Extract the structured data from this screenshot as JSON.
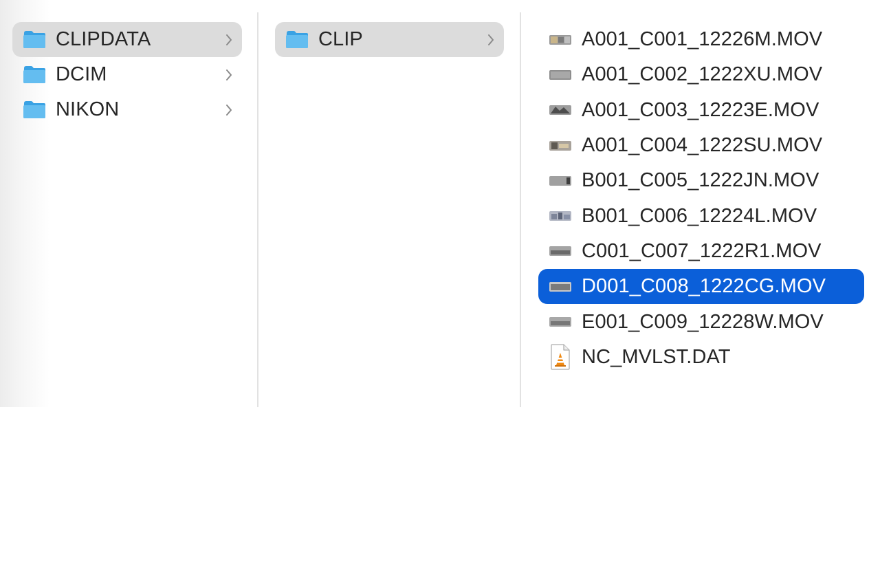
{
  "columns": [
    {
      "items": [
        {
          "label": "CLIPDATA",
          "selected": true
        },
        {
          "label": "DCIM",
          "selected": false
        },
        {
          "label": "NIKON",
          "selected": false
        }
      ]
    },
    {
      "items": [
        {
          "label": "CLIP",
          "selected": true
        }
      ]
    },
    {
      "items": [
        {
          "label": "A001_C001_12226M.MOV",
          "icon": "video-thumbnail-icon"
        },
        {
          "label": "A001_C002_1222XU.MOV",
          "icon": "video-thumbnail-icon"
        },
        {
          "label": "A001_C003_12223E.MOV",
          "icon": "video-thumbnail-icon"
        },
        {
          "label": "A001_C004_1222SU.MOV",
          "icon": "video-thumbnail-icon"
        },
        {
          "label": "B001_C005_1222JN.MOV",
          "icon": "video-thumbnail-icon"
        },
        {
          "label": "B001_C006_12224L.MOV",
          "icon": "video-thumbnail-icon"
        },
        {
          "label": "C001_C007_1222R1.MOV",
          "icon": "video-thumbnail-icon"
        },
        {
          "label": "D001_C008_1222CG.MOV",
          "icon": "video-thumbnail-icon",
          "selected": true
        },
        {
          "label": "E001_C009_12228W.MOV",
          "icon": "video-thumbnail-icon"
        },
        {
          "label": "NC_MVLST.DAT",
          "icon": "vlc-document-icon"
        }
      ]
    }
  ],
  "colors": {
    "selection_blue": "#0b5fd9",
    "selection_grey": "#dcdcdc",
    "folder_blue": "#5bb8ee",
    "text": "#262626"
  }
}
